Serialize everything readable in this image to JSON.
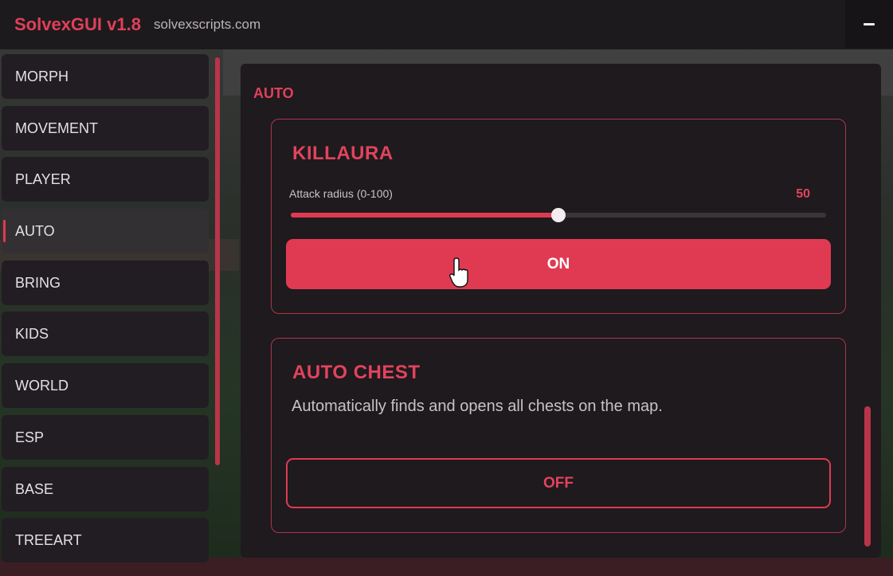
{
  "window": {
    "title": "SolvexGUI v1.8",
    "site": "solvexscripts.com",
    "minimize_icon": "minus-icon"
  },
  "sidebar": {
    "items": [
      {
        "label": "MORPH",
        "active": false
      },
      {
        "label": "MOVEMENT",
        "active": false
      },
      {
        "label": "PLAYER",
        "active": false
      },
      {
        "label": "AUTO",
        "active": true
      },
      {
        "label": "BRING",
        "active": false
      },
      {
        "label": "KIDS",
        "active": false
      },
      {
        "label": "WORLD",
        "active": false
      },
      {
        "label": "ESP",
        "active": false
      },
      {
        "label": "BASE",
        "active": false
      },
      {
        "label": "TREEART",
        "active": false
      }
    ]
  },
  "main": {
    "section_title": "AUTO",
    "killaura": {
      "title": "KILLAURA",
      "slider_label": "Attack radius (0-100)",
      "slider_value": "50",
      "slider_min": 0,
      "slider_max": 100,
      "slider_level": 50,
      "button_label": "ON"
    },
    "auto_chest": {
      "title": "AUTO CHEST",
      "description": "Automatically finds and opens all chests on the map.",
      "button_label": "OFF"
    }
  },
  "colors": {
    "accent": "#e03a52",
    "panel": "#1e1a1e",
    "sidebar_item": "#221d22",
    "active_item": "#333033"
  }
}
